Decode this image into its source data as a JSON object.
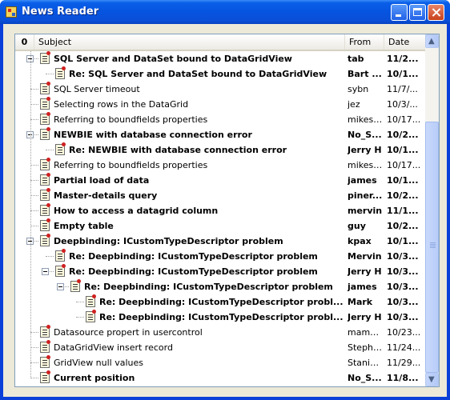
{
  "window": {
    "title": "News Reader"
  },
  "columns": {
    "attach": "0",
    "subject": "Subject",
    "from": "From",
    "date": "Date"
  },
  "rows": [
    {
      "level": 0,
      "bold": true,
      "expanded": true,
      "subject": "SQL Server and DataSet bound to DataGridView",
      "from": "tab",
      "date": "11/2..."
    },
    {
      "level": 1,
      "bold": true,
      "expanded": false,
      "subject": "Re: SQL Server and DataSet bound to DataGridView",
      "from": "Bart ...",
      "date": "10/1..."
    },
    {
      "level": 0,
      "bold": false,
      "expanded": false,
      "subject": "SQL Server timeout",
      "from": "sybn",
      "date": "11/7/..."
    },
    {
      "level": 0,
      "bold": false,
      "expanded": false,
      "subject": "Selecting rows in the DataGrid",
      "from": "jez",
      "date": "10/3/..."
    },
    {
      "level": 0,
      "bold": false,
      "expanded": false,
      "subject": "Referring to boundfields properties",
      "from": "mikesl...",
      "date": "10/17..."
    },
    {
      "level": 0,
      "bold": true,
      "expanded": true,
      "subject": "NEWBIE with database connection error",
      "from": "No_S...",
      "date": "10/2..."
    },
    {
      "level": 1,
      "bold": true,
      "expanded": false,
      "subject": "Re: NEWBIE with database connection error",
      "from": "Jerry H",
      "date": "10/1..."
    },
    {
      "level": 0,
      "bold": false,
      "expanded": false,
      "subject": "Referring to boundfields properties",
      "from": "mikesl...",
      "date": "10/17..."
    },
    {
      "level": 0,
      "bold": true,
      "expanded": false,
      "subject": "Partial load of data",
      "from": "james",
      "date": "10/1..."
    },
    {
      "level": 0,
      "bold": true,
      "expanded": false,
      "subject": "Master-details query",
      "from": "piner...",
      "date": "10/2..."
    },
    {
      "level": 0,
      "bold": true,
      "expanded": false,
      "subject": "How to access a datagrid column",
      "from": "mervin",
      "date": "11/1..."
    },
    {
      "level": 0,
      "bold": true,
      "expanded": false,
      "subject": "Empty table",
      "from": "guy",
      "date": "10/2..."
    },
    {
      "level": 0,
      "bold": true,
      "expanded": true,
      "subject": "Deepbinding: ICustomTypeDescriptor problem",
      "from": "kpax",
      "date": "10/1..."
    },
    {
      "level": 1,
      "bold": true,
      "expanded": false,
      "subject": "Re: Deepbinding: ICustomTypeDescriptor problem",
      "from": "Mervin",
      "date": "10/3..."
    },
    {
      "level": 1,
      "bold": true,
      "expanded": true,
      "subject": "Re: Deepbinding: ICustomTypeDescriptor problem",
      "from": "Jerry H",
      "date": "10/3..."
    },
    {
      "level": 2,
      "bold": true,
      "expanded": true,
      "subject": "Re: Deepbinding: ICustomTypeDescriptor problem",
      "from": "james",
      "date": "10/3..."
    },
    {
      "level": 3,
      "bold": true,
      "expanded": false,
      "subject": "Re: Deepbinding: ICustomTypeDescriptor probl...",
      "from": "Mark",
      "date": "10/3..."
    },
    {
      "level": 3,
      "bold": true,
      "expanded": false,
      "subject": "Re: Deepbinding: ICustomTypeDescriptor probl...",
      "from": "Jerry H",
      "date": "10/3..."
    },
    {
      "level": 0,
      "bold": false,
      "expanded": false,
      "subject": "Datasource propert in usercontrol",
      "from": "mamaike",
      "date": "10/23..."
    },
    {
      "level": 0,
      "bold": false,
      "expanded": false,
      "subject": "DataGridView insert record",
      "from": "Stephen",
      "date": "11/24..."
    },
    {
      "level": 0,
      "bold": false,
      "expanded": false,
      "subject": "GridView null values",
      "from": "Stanis...",
      "date": "11/29..."
    },
    {
      "level": 0,
      "bold": true,
      "expanded": false,
      "subject": "Current position",
      "from": "No_S...",
      "date": "11/8..."
    }
  ],
  "scrollbar": {
    "up_arrow": "▲",
    "down_arrow": "▼"
  }
}
